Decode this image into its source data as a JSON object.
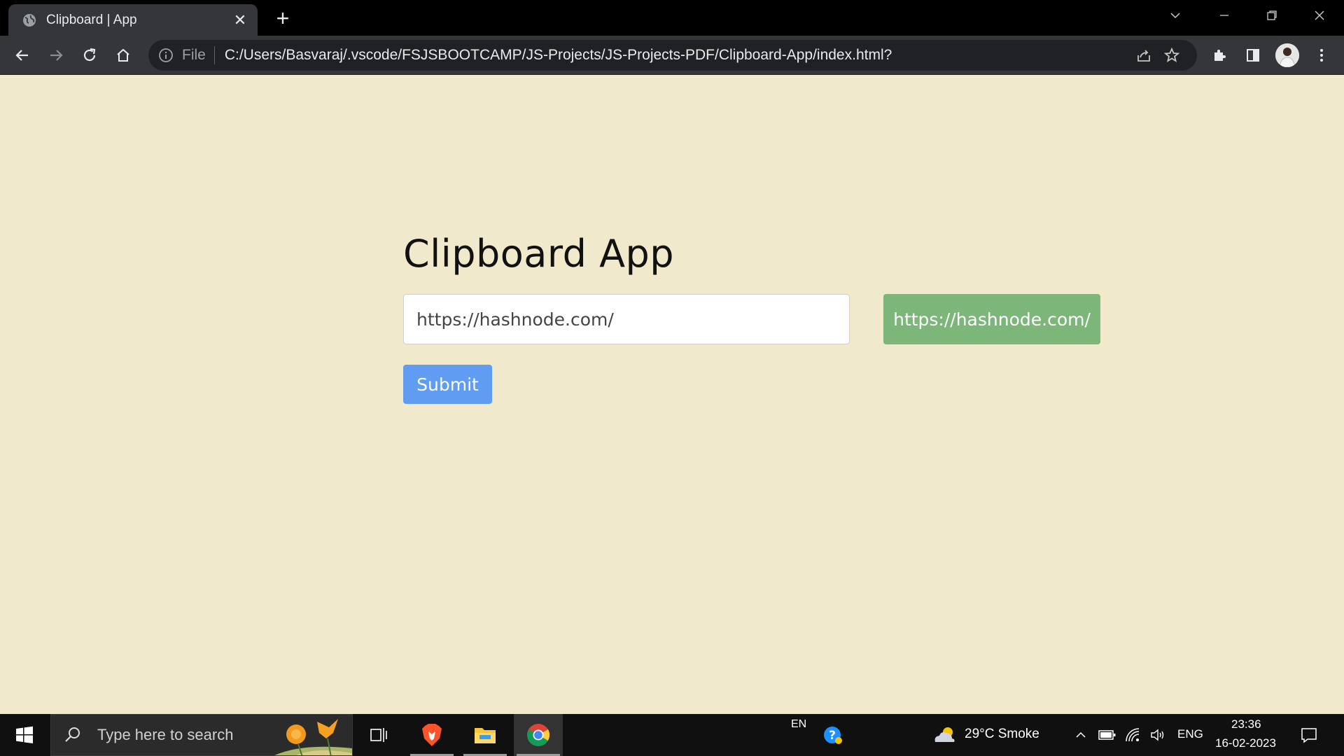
{
  "browser": {
    "tab_title": "Clipboard | App",
    "new_tab_label": "+",
    "omnibox": {
      "scheme_label": "File",
      "url": "C:/Users/Basvaraj/.vscode/FSJSBOOTCAMP/JS-Projects/JS-Projects-PDF/Clipboard-App/index.html?"
    }
  },
  "page": {
    "title": "Clipboard App",
    "input_value": "https://hashnode.com/",
    "copied_text": "https://hashnode.com/",
    "submit_label": "Submit"
  },
  "taskbar": {
    "search_placeholder": "Type here to search",
    "input_indicator": "EN",
    "weather": "29°C  Smoke",
    "language": "ENG",
    "time": "23:36",
    "date": "16-02-2023"
  },
  "colors": {
    "page_background": "#f0e9cc",
    "copied_box": "#7cb679",
    "submit_button": "#5f9cf2"
  }
}
